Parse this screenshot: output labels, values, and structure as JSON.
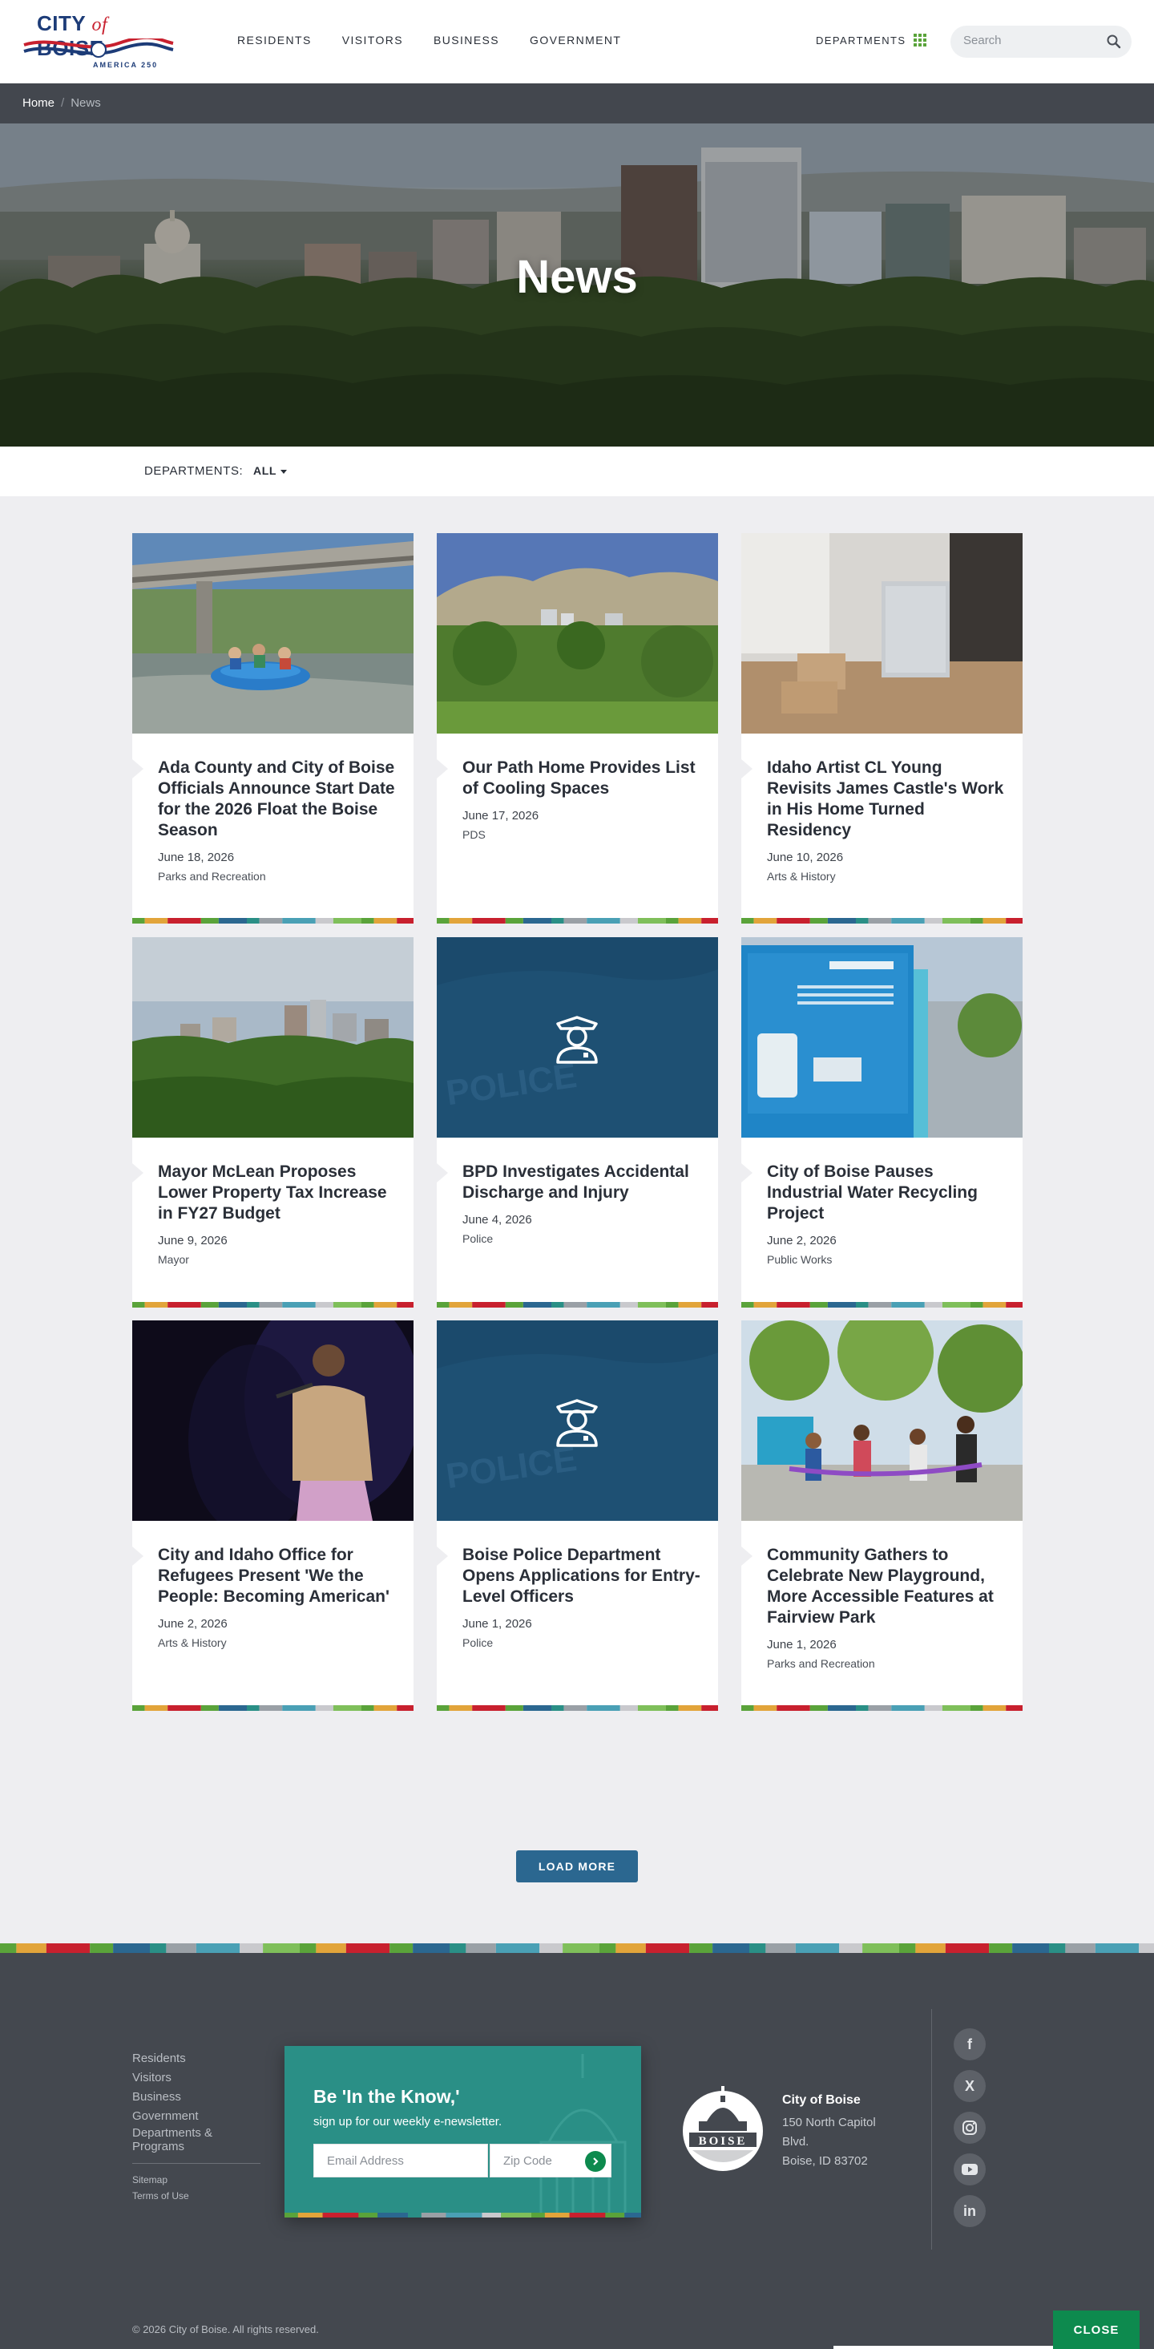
{
  "header": {
    "logo_text": "CITY of BOISE",
    "logo_city": "CITY",
    "logo_of": "of",
    "logo_boise": "BOISE",
    "logo_sub": "AMERICA 250",
    "nav": [
      "RESIDENTS",
      "VISITORS",
      "BUSINESS",
      "GOVERNMENT"
    ],
    "departments_label": "DEPARTMENTS",
    "search_placeholder": "Search"
  },
  "breadcrumb": {
    "home": "Home",
    "separator": "/",
    "current": "News"
  },
  "hero": {
    "title": "News"
  },
  "filter": {
    "label": "DEPARTMENTS:",
    "value": "ALL"
  },
  "cards": [
    {
      "title": "Ada County and City of Boise Officials Announce Start Date for the 2026 Float the Boise Season",
      "date": "June 18, 2026",
      "category": "Parks and Recreation",
      "image": "river-rafting-photo"
    },
    {
      "title": "Our Path Home Provides List of Cooling Spaces",
      "date": "June 17, 2026",
      "category": "PDS",
      "image": "city-foothills-photo"
    },
    {
      "title": "Idaho Artist CL Young Revisits James Castle's Work in His Home Turned Residency",
      "date": "June 10, 2026",
      "category": "Arts & History",
      "image": "art-residency-photo"
    },
    {
      "title": "Mayor McLean Proposes Lower Property Tax Increase in FY27 Budget",
      "date": "June 9, 2026",
      "category": "Mayor",
      "image": "skyline-photo"
    },
    {
      "title": "BPD Investigates Accidental Discharge and Injury",
      "date": "June 4, 2026",
      "category": "Police",
      "image": "police-officer-icon"
    },
    {
      "title": "City of Boise Pauses Industrial Water Recycling Project",
      "date": "June 2, 2026",
      "category": "Public Works",
      "image": "ultrafiltration-photo"
    },
    {
      "title": "City and Idaho Office for Refugees Present 'We the People: Becoming American'",
      "date": "June 2, 2026",
      "category": "Arts & History",
      "image": "singer-stage-photo"
    },
    {
      "title": "Boise Police Department Opens Applications for Entry-Level Officers",
      "date": "June 1, 2026",
      "category": "Police",
      "image": "police-officer-icon"
    },
    {
      "title": "Community Gathers to Celebrate New Playground, More Accessible Features at Fairview Park",
      "date": "June 1, 2026",
      "category": "Parks and Recreation",
      "image": "playground-ribbon-photo"
    }
  ],
  "load_more": "LOAD MORE",
  "footer": {
    "links": [
      "Residents",
      "Visitors",
      "Business",
      "Government",
      "Departments & Programs"
    ],
    "small_links": [
      "Sitemap",
      "Terms of Use"
    ],
    "newsletter_title": "Be 'In the Know,'",
    "newsletter_sub": "sign up for our weekly e-newsletter.",
    "email_placeholder": "Email Address",
    "zip_placeholder": "Zip Code",
    "seal_text": "BOISE",
    "org_name": "City of Boise",
    "address_line1": "150 North Capitol",
    "address_line2": "Blvd.",
    "address_line3": "Boise, ID 83702",
    "social": [
      "facebook-icon",
      "x-icon",
      "instagram-icon",
      "youtube-icon",
      "linkedin-icon"
    ],
    "social_glyphs": [
      "f",
      "X",
      "",
      "",
      "in"
    ],
    "copyright": "© 2026 City of Boise. All rights reserved.",
    "close_label": "CLOSE"
  },
  "colors": {
    "brand_blue": "#1d3c78",
    "brand_red": "#c8202e",
    "load_more_blue": "#2b6790",
    "footer_bg": "#44484f",
    "newsletter_teal": "#2a8f86",
    "close_green": "#0d8a4e"
  }
}
